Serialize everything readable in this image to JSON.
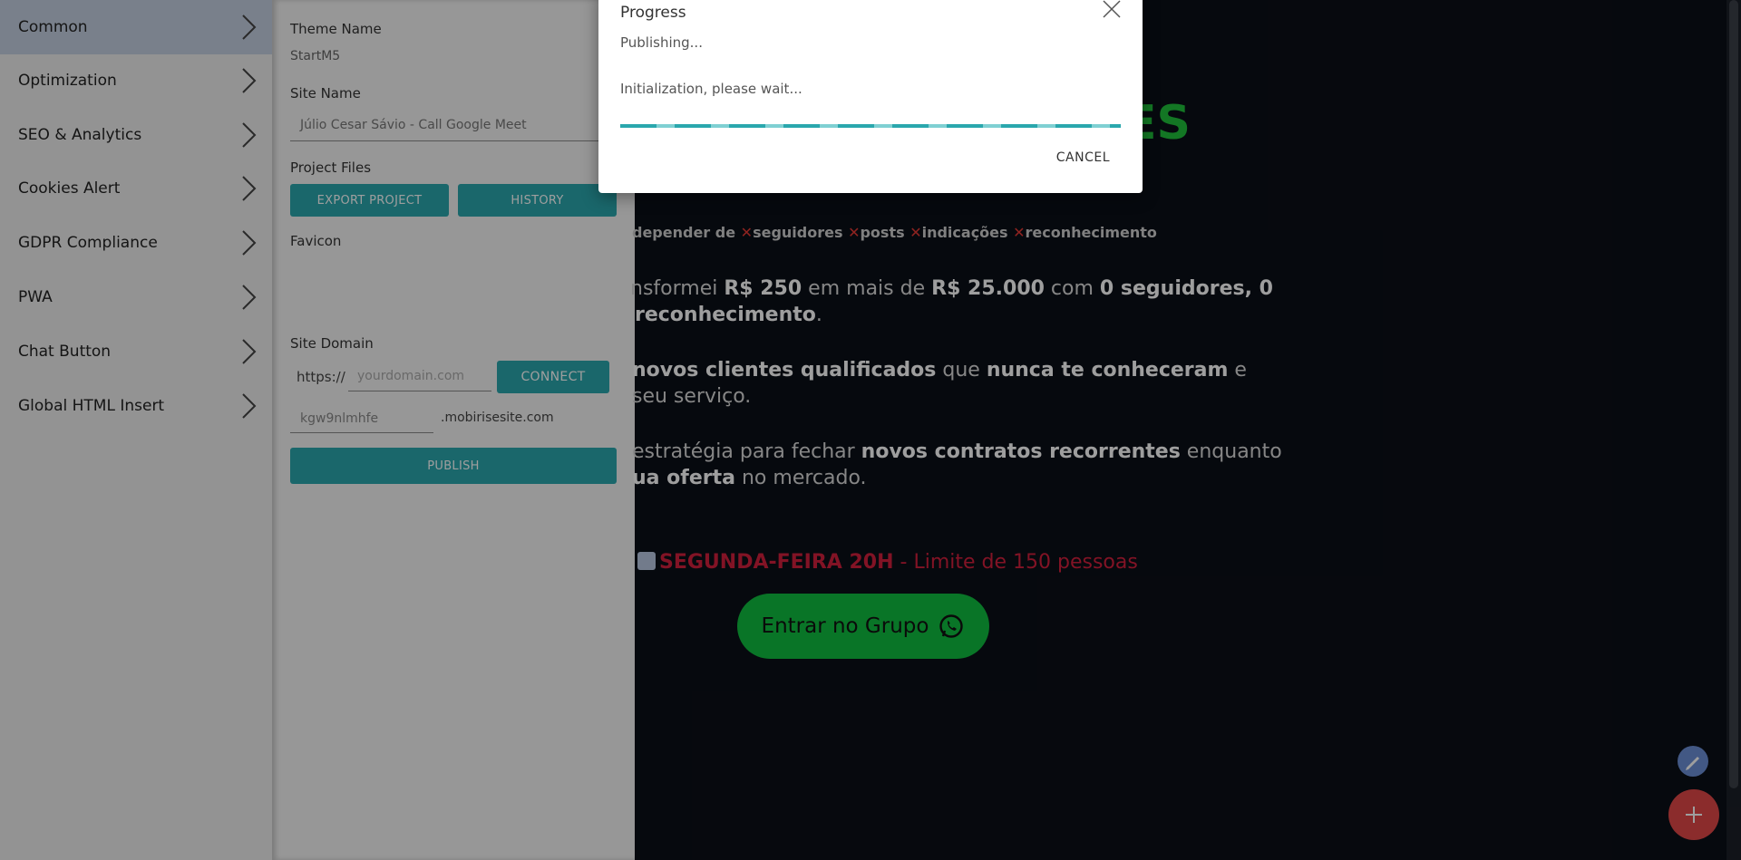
{
  "left_menu": {
    "items": [
      {
        "label": "Common"
      },
      {
        "label": "Optimization"
      },
      {
        "label": "SEO & Analytics"
      },
      {
        "label": "Cookies Alert"
      },
      {
        "label": "GDPR Compliance"
      },
      {
        "label": "PWA"
      },
      {
        "label": "Chat Button"
      },
      {
        "label": "Global HTML Insert"
      }
    ]
  },
  "settings": {
    "theme_name_label": "Theme Name",
    "theme_name_value": "StartM5",
    "site_name_label": "Site Name",
    "site_name_value": "Júlio Cesar Sávio - Call Google Meet",
    "project_files_label": "Project Files",
    "export_button": "EXPORT PROJECT",
    "history_button": "HISTORY",
    "favicon_label": "Favicon",
    "site_domain_label": "Site Domain",
    "domain_prefix": "https://",
    "domain_placeholder": "yourdomain.com",
    "connect_button": "CONNECT",
    "subdomain_value": "kgw9nlmhfe",
    "subdomain_suffix": ".mobirisesite.com",
    "publish_button": "PUBLISH"
  },
  "preview": {
    "heading_fragment": "ES",
    "line1_start": "depender de",
    "line1_items": [
      "seguidores",
      "posts",
      "indicações",
      "reconhecimento"
    ],
    "p1_line1_a": "nsformei ",
    "p1_line1_b": "R$ 250",
    "p1_line1_c": " em mais de ",
    "p1_line1_d": "R$ 25.000",
    "p1_line1_e": " com ",
    "p1_line1_f": "0 seguidores, 0",
    "p1_line2_a": "reconhecimento",
    "p1_line2_b": ".",
    "p2_line1_a": "novos clientes qualificados",
    "p2_line1_b": " que ",
    "p2_line1_c": "nunca te conheceram",
    "p2_line1_d": " e",
    "p2_line2": "seu serviço.",
    "p3_line1_a": "estratégia para fechar ",
    "p3_line1_b": "novos contratos recorrentes",
    "p3_line1_c": " enquanto",
    "p3_line2_a": "ua oferta",
    "p3_line2_b": " no mercado.",
    "date_bold": "SEGUNDA-FEIRA 20H",
    "date_rest": " - Limite de 150 pessoas",
    "cta_label": "Entrar no Grupo"
  },
  "dialog": {
    "title": "Progress",
    "status": "Publishing...",
    "message": "Initialization, please wait...",
    "progress": 1.0,
    "cancel_label": "CANCEL"
  },
  "colors": {
    "teal": "#2aa7ad",
    "green": "#1fc13a",
    "red": "#e04848",
    "date_red": "#d21f3c"
  }
}
